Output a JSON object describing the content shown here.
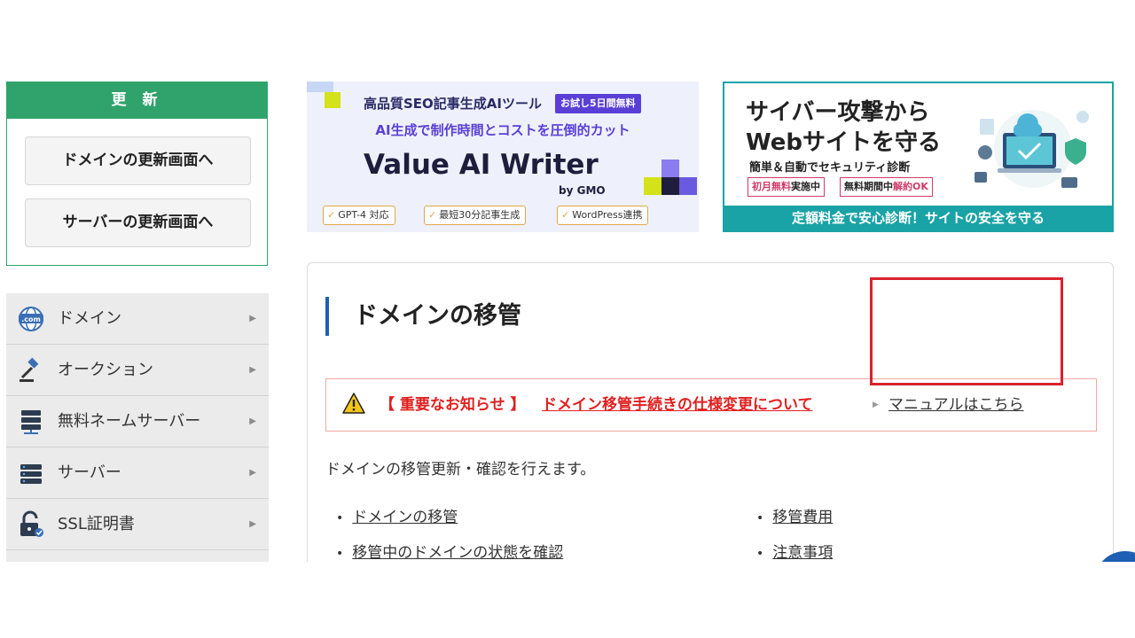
{
  "renew": {
    "heading": "更 新",
    "domain_button": "ドメインの更新画面へ",
    "server_button": "サーバーの更新画面へ"
  },
  "nav": {
    "items": [
      {
        "label": "ドメイン",
        "icon": "globe-com-icon"
      },
      {
        "label": "オークション",
        "icon": "gavel-icon"
      },
      {
        "label": "無料ネームサーバー",
        "icon": "name-server-icon"
      },
      {
        "label": "サーバー",
        "icon": "server-icon"
      },
      {
        "label": "SSL証明書",
        "icon": "lock-icon"
      }
    ]
  },
  "banner1": {
    "headline": "高品質SEO記事生成AIツール",
    "trial_tag": "お試し5日間無料",
    "subline": "AI生成で制作時間とコストを圧倒的カット",
    "logo": "Value AI Writer",
    "by": "by GMO",
    "features": [
      "GPT-4 対応",
      "最短30分記事生成",
      "WordPress連携"
    ]
  },
  "banner2": {
    "title_line1": "サイバー攻撃から",
    "title_line2": "Webサイトを守る",
    "subtitle": "簡単＆自動でセキュリティ診断",
    "tag1_hl": "初月無料",
    "tag1_rest": "実施中",
    "tag2_rest": "無料期間中",
    "tag2_hl": "解約OK",
    "footer": "定額料金で安心診断！サイトの安全を守る"
  },
  "main": {
    "title": "ドメインの移管",
    "notice_label": "【 重要なお知らせ 】",
    "notice_link": "ドメイン移管手続きの仕様変更について",
    "manual_link": "マニュアルはこちら",
    "description": "ドメインの移管更新・確認を行えます。",
    "links": {
      "transfer": "ドメインの移管",
      "status": "移管中のドメインの状態を確認",
      "fee": "移管費用",
      "notes": "注意事項"
    }
  },
  "colors": {
    "green": "#2fa36b",
    "teal": "#1aa3a6",
    "blue": "#1f5fb4",
    "notice_red": "#e02020",
    "highlight_red": "#d9232e"
  }
}
